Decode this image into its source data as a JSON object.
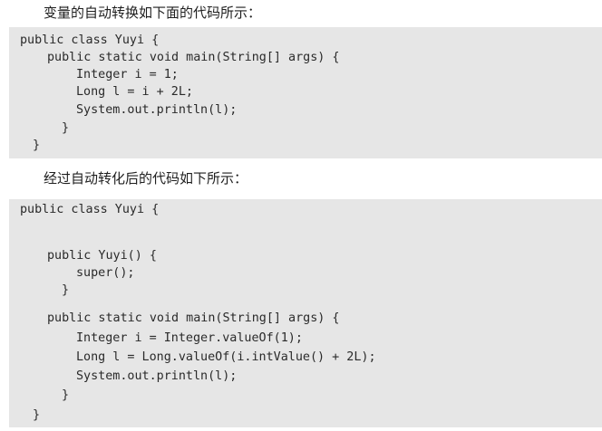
{
  "intro_text": "变量的自动转换如下面的代码所示：",
  "code_before": [
    "public class Yuyi {",
    "public static void main(String[] args) {",
    "Integer i = 1;",
    "Long l = i + 2L;",
    "System.out.println(l);",
    "}",
    "}"
  ],
  "after_text": "经过自动转化后的代码如下所示：",
  "code_after": [
    "public class Yuyi {",
    "public Yuyi() {",
    "super();",
    "}",
    "public static void main(String[] args) {",
    "Integer i = Integer.valueOf(1);",
    "Long l = Long.valueOf(i.intValue() + 2L);",
    "System.out.println(l);",
    "}",
    "}"
  ]
}
